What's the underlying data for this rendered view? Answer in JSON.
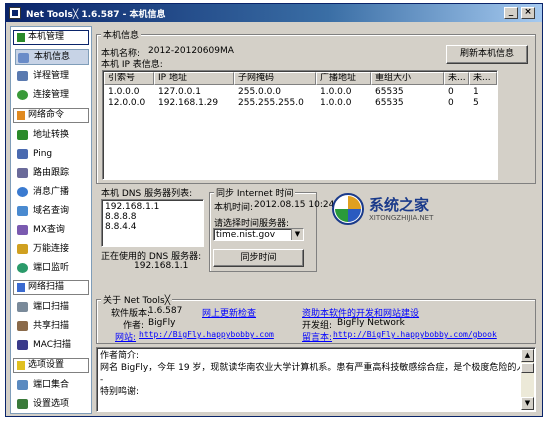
{
  "window": {
    "title": "Net Tools╳ 1.6.587 - 本机信息"
  },
  "sidebar": {
    "groups": [
      {
        "label": "本机管理",
        "items": [
          "本机信息",
          "详程管理",
          "连接管理"
        ]
      },
      {
        "label": "网络命令",
        "items": [
          "地址转换",
          "Ping",
          "路由跟踪",
          "消息广播",
          "域名查询",
          "MX查询",
          "万能连接",
          "端口监听"
        ]
      },
      {
        "label": "网络扫描",
        "items": [
          "端口扫描",
          "共享扫描",
          "MAC扫描"
        ]
      },
      {
        "label": "选项设置",
        "items": [
          "端口集合",
          "设置选项"
        ]
      }
    ]
  },
  "host": {
    "section_label": "本机信息",
    "name_label": "本机名称:",
    "name_value": "2012-20120609MA",
    "ip_table_label": "本机 IP 表信息:",
    "refresh_button": "刷新本机信息",
    "columns": [
      "引索号",
      "IP 地址",
      "子网掩码",
      "广播地址",
      "重组大小",
      "未...",
      "未..."
    ],
    "rows": [
      [
        "1.0.0.0",
        "127.0.0.1",
        "255.0.0.0",
        "1.0.0.0",
        "65535",
        "0",
        "1"
      ],
      [
        "12.0.0.0",
        "192.168.1.29",
        "255.255.255.0",
        "1.0.0.0",
        "65535",
        "0",
        "5"
      ]
    ]
  },
  "dns": {
    "list_label": "本机 DNS 服务器列表:",
    "servers": [
      "192.168.1.1",
      "8.8.8.8",
      "8.8.4.4"
    ],
    "in_use_label": "正在使用的 DNS 服务器:",
    "in_use_value": "192.168.1.1"
  },
  "sync": {
    "section_label": "同步 Internet 时间",
    "local_time_label": "本机时间:",
    "local_time_value": "2012.08.15 10:24:06",
    "server_label": "请选择时间服务器:",
    "server_value": "time.nist.gov",
    "sync_button": "同步时间"
  },
  "about": {
    "section_label": "关于 Net Tools╳",
    "version_label": "软件版本:",
    "version_value": "1.6.587",
    "update_link": "网上更新检查",
    "donate_link": "资助本软件的开发和网站建设",
    "author_label": "作者:",
    "author_value": "BigFly",
    "dev_label": "开发组:",
    "dev_value": "BigFly Network",
    "site_label": "网站:",
    "site_value": "http://BigFly.happybobby.com",
    "board_label": "留言本:",
    "board_value": "http://BigFly.happybobby.com/gbook"
  },
  "intro": {
    "title": "作者简介:",
    "body": "网名 BigFly，今年 19 岁，现就读华南农业大学计算机系。患有严重高科技敏感综合症，是个极度危险的人",
    "dash": "-",
    "thanks": "特别鸣谢:"
  },
  "watermark": {
    "brand": "系统之家",
    "domain": "XITONGZHIJIA.NET"
  }
}
